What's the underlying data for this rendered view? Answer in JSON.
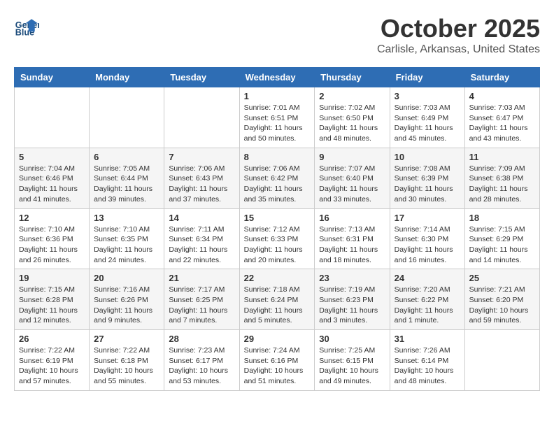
{
  "header": {
    "logo_line1": "General",
    "logo_line2": "Blue",
    "month": "October 2025",
    "location": "Carlisle, Arkansas, United States"
  },
  "weekdays": [
    "Sunday",
    "Monday",
    "Tuesday",
    "Wednesday",
    "Thursday",
    "Friday",
    "Saturday"
  ],
  "weeks": [
    [
      {
        "day": "",
        "info": ""
      },
      {
        "day": "",
        "info": ""
      },
      {
        "day": "",
        "info": ""
      },
      {
        "day": "1",
        "info": "Sunrise: 7:01 AM\nSunset: 6:51 PM\nDaylight: 11 hours\nand 50 minutes."
      },
      {
        "day": "2",
        "info": "Sunrise: 7:02 AM\nSunset: 6:50 PM\nDaylight: 11 hours\nand 48 minutes."
      },
      {
        "day": "3",
        "info": "Sunrise: 7:03 AM\nSunset: 6:49 PM\nDaylight: 11 hours\nand 45 minutes."
      },
      {
        "day": "4",
        "info": "Sunrise: 7:03 AM\nSunset: 6:47 PM\nDaylight: 11 hours\nand 43 minutes."
      }
    ],
    [
      {
        "day": "5",
        "info": "Sunrise: 7:04 AM\nSunset: 6:46 PM\nDaylight: 11 hours\nand 41 minutes."
      },
      {
        "day": "6",
        "info": "Sunrise: 7:05 AM\nSunset: 6:44 PM\nDaylight: 11 hours\nand 39 minutes."
      },
      {
        "day": "7",
        "info": "Sunrise: 7:06 AM\nSunset: 6:43 PM\nDaylight: 11 hours\nand 37 minutes."
      },
      {
        "day": "8",
        "info": "Sunrise: 7:06 AM\nSunset: 6:42 PM\nDaylight: 11 hours\nand 35 minutes."
      },
      {
        "day": "9",
        "info": "Sunrise: 7:07 AM\nSunset: 6:40 PM\nDaylight: 11 hours\nand 33 minutes."
      },
      {
        "day": "10",
        "info": "Sunrise: 7:08 AM\nSunset: 6:39 PM\nDaylight: 11 hours\nand 30 minutes."
      },
      {
        "day": "11",
        "info": "Sunrise: 7:09 AM\nSunset: 6:38 PM\nDaylight: 11 hours\nand 28 minutes."
      }
    ],
    [
      {
        "day": "12",
        "info": "Sunrise: 7:10 AM\nSunset: 6:36 PM\nDaylight: 11 hours\nand 26 minutes."
      },
      {
        "day": "13",
        "info": "Sunrise: 7:10 AM\nSunset: 6:35 PM\nDaylight: 11 hours\nand 24 minutes."
      },
      {
        "day": "14",
        "info": "Sunrise: 7:11 AM\nSunset: 6:34 PM\nDaylight: 11 hours\nand 22 minutes."
      },
      {
        "day": "15",
        "info": "Sunrise: 7:12 AM\nSunset: 6:33 PM\nDaylight: 11 hours\nand 20 minutes."
      },
      {
        "day": "16",
        "info": "Sunrise: 7:13 AM\nSunset: 6:31 PM\nDaylight: 11 hours\nand 18 minutes."
      },
      {
        "day": "17",
        "info": "Sunrise: 7:14 AM\nSunset: 6:30 PM\nDaylight: 11 hours\nand 16 minutes."
      },
      {
        "day": "18",
        "info": "Sunrise: 7:15 AM\nSunset: 6:29 PM\nDaylight: 11 hours\nand 14 minutes."
      }
    ],
    [
      {
        "day": "19",
        "info": "Sunrise: 7:15 AM\nSunset: 6:28 PM\nDaylight: 11 hours\nand 12 minutes."
      },
      {
        "day": "20",
        "info": "Sunrise: 7:16 AM\nSunset: 6:26 PM\nDaylight: 11 hours\nand 9 minutes."
      },
      {
        "day": "21",
        "info": "Sunrise: 7:17 AM\nSunset: 6:25 PM\nDaylight: 11 hours\nand 7 minutes."
      },
      {
        "day": "22",
        "info": "Sunrise: 7:18 AM\nSunset: 6:24 PM\nDaylight: 11 hours\nand 5 minutes."
      },
      {
        "day": "23",
        "info": "Sunrise: 7:19 AM\nSunset: 6:23 PM\nDaylight: 11 hours\nand 3 minutes."
      },
      {
        "day": "24",
        "info": "Sunrise: 7:20 AM\nSunset: 6:22 PM\nDaylight: 11 hours\nand 1 minute."
      },
      {
        "day": "25",
        "info": "Sunrise: 7:21 AM\nSunset: 6:20 PM\nDaylight: 10 hours\nand 59 minutes."
      }
    ],
    [
      {
        "day": "26",
        "info": "Sunrise: 7:22 AM\nSunset: 6:19 PM\nDaylight: 10 hours\nand 57 minutes."
      },
      {
        "day": "27",
        "info": "Sunrise: 7:22 AM\nSunset: 6:18 PM\nDaylight: 10 hours\nand 55 minutes."
      },
      {
        "day": "28",
        "info": "Sunrise: 7:23 AM\nSunset: 6:17 PM\nDaylight: 10 hours\nand 53 minutes."
      },
      {
        "day": "29",
        "info": "Sunrise: 7:24 AM\nSunset: 6:16 PM\nDaylight: 10 hours\nand 51 minutes."
      },
      {
        "day": "30",
        "info": "Sunrise: 7:25 AM\nSunset: 6:15 PM\nDaylight: 10 hours\nand 49 minutes."
      },
      {
        "day": "31",
        "info": "Sunrise: 7:26 AM\nSunset: 6:14 PM\nDaylight: 10 hours\nand 48 minutes."
      },
      {
        "day": "",
        "info": ""
      }
    ]
  ]
}
